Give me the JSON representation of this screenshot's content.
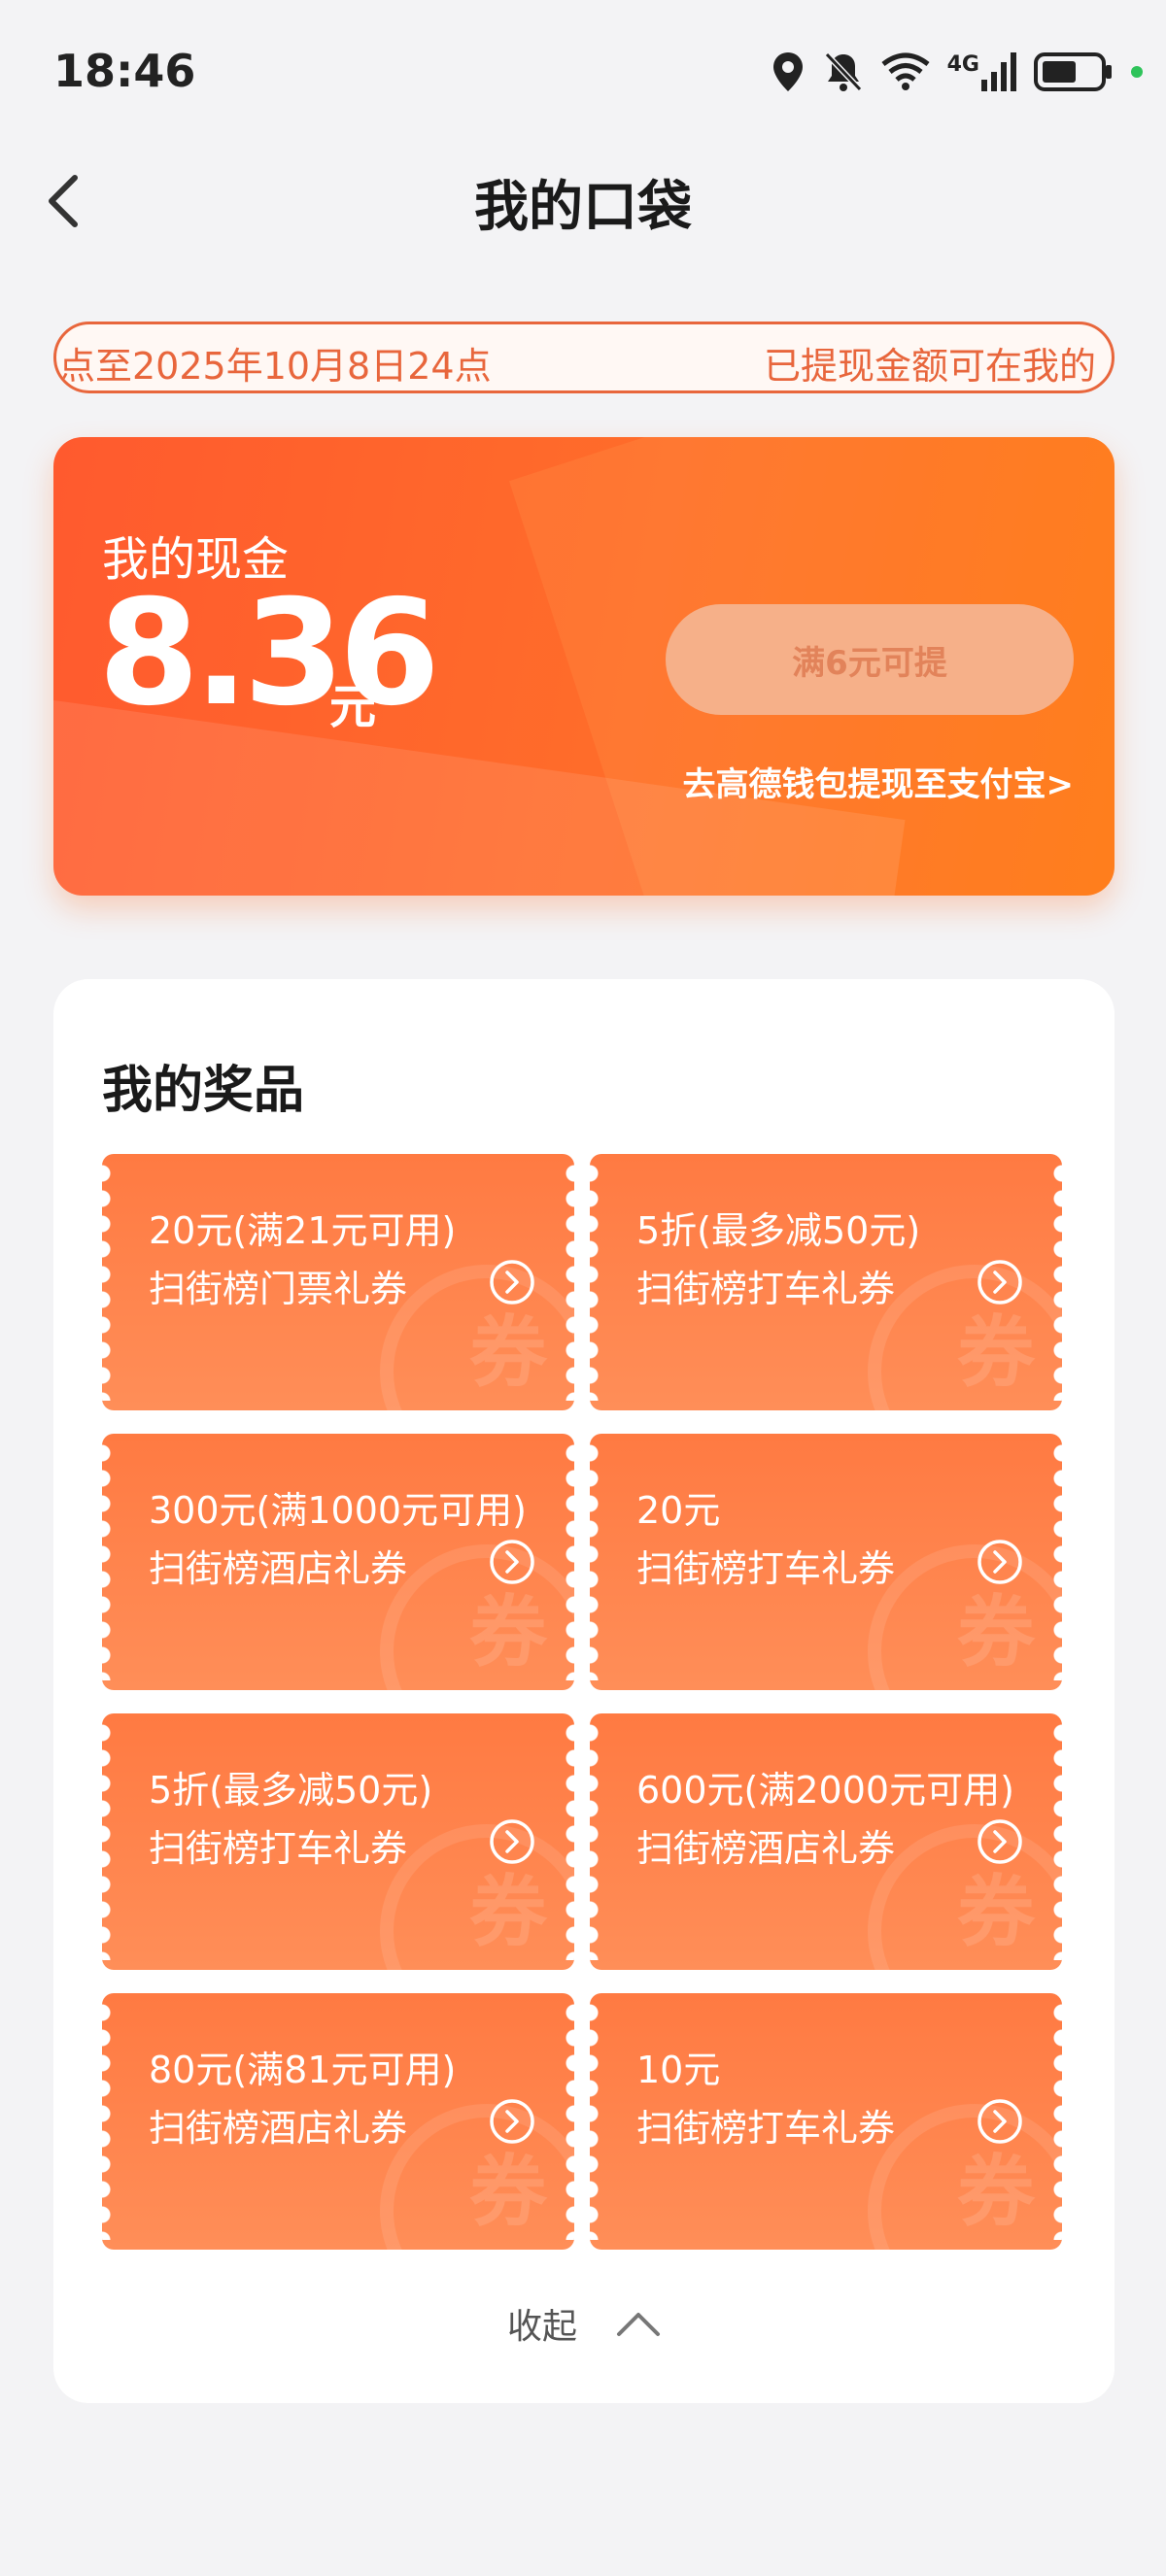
{
  "status_bar": {
    "time": "18:46",
    "network": "4G"
  },
  "nav": {
    "title": "我的口袋"
  },
  "notice": {
    "text_left": "点至2025年10月8日24点",
    "text_right": "已提现金额可在我的"
  },
  "cash": {
    "label": "我的现金",
    "amount": "8.36",
    "unit": "元",
    "withdraw_label": "满6元可提",
    "wallet_link": "去高德钱包提现至支付宝>"
  },
  "prizes": {
    "title": "我的奖品",
    "coupons": [
      {
        "value": "20元(满21元可用)",
        "name": "扫街榜门票礼券"
      },
      {
        "value": "5折(最多减50元)",
        "name": "扫街榜打车礼券"
      },
      {
        "value": "300元(满1000元可用)",
        "name": "扫街榜酒店礼券"
      },
      {
        "value": "20元",
        "name": "扫街榜打车礼券"
      },
      {
        "value": "5折(最多减50元)",
        "name": "扫街榜打车礼券"
      },
      {
        "value": "600元(满2000元可用)",
        "name": "扫街榜酒店礼券"
      },
      {
        "value": "80元(满81元可用)",
        "name": "扫街榜酒店礼券"
      },
      {
        "value": "10元",
        "name": "扫街榜打车礼券"
      }
    ],
    "collapse_label": "收起"
  },
  "colors": {
    "accent": "#ff6d2a",
    "coupon": "#ff7a42",
    "background": "#f3f3f5"
  }
}
